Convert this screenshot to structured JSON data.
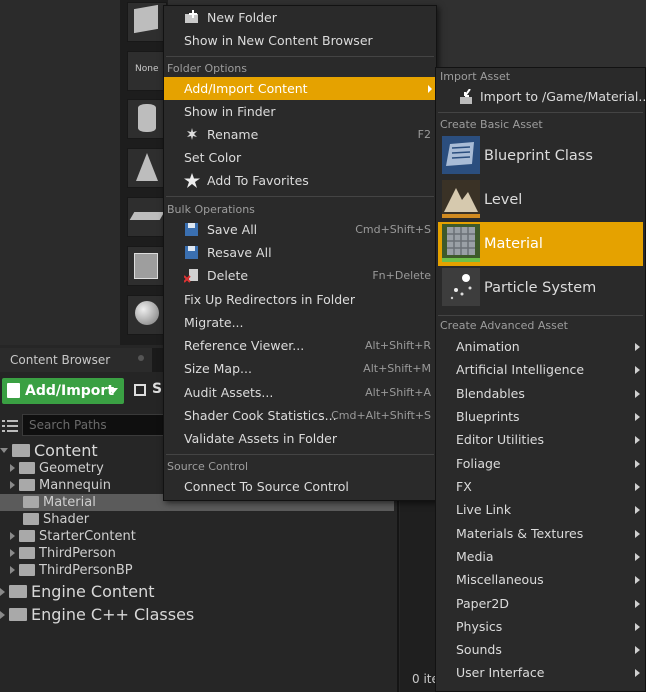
{
  "viewport": {
    "mode_tiles": [
      {
        "name": "cube-icon",
        "label": ""
      },
      {
        "name": "none-tile",
        "label": "None"
      },
      {
        "name": "cylinder-icon",
        "label": ""
      },
      {
        "name": "cone-icon",
        "label": ""
      },
      {
        "name": "plane-icon",
        "label": ""
      },
      {
        "name": "box-icon",
        "label": ""
      },
      {
        "name": "sphere-icon",
        "label": ""
      }
    ]
  },
  "content_browser": {
    "tab_label": "Content Browser",
    "add_import_label": "Add/Import",
    "save_label": "S",
    "search_placeholder": "Search Paths",
    "tree": [
      {
        "label": "Content",
        "level": 0,
        "expanded": true,
        "big": true
      },
      {
        "label": "Geometry",
        "level": 1,
        "expanded": false
      },
      {
        "label": "Mannequin",
        "level": 1,
        "expanded": false
      },
      {
        "label": "Material",
        "level": 1,
        "expanded": null,
        "selected": true
      },
      {
        "label": "Shader",
        "level": 1,
        "expanded": null
      },
      {
        "label": "StarterContent",
        "level": 1,
        "expanded": false
      },
      {
        "label": "ThirdPerson",
        "level": 1,
        "expanded": false
      },
      {
        "label": "ThirdPersonBP",
        "level": 1,
        "expanded": false
      },
      {
        "label": "Engine Content",
        "level": 0,
        "expanded": false,
        "big": true
      },
      {
        "label": "Engine C++ Classes",
        "level": 0,
        "expanded": false,
        "big": true
      }
    ],
    "items_count": "0 ite"
  },
  "context_menu": {
    "items_top": [
      {
        "label": "New Folder",
        "icon": "new-folder-icon"
      },
      {
        "label": "Show in New Content Browser",
        "icon": ""
      }
    ],
    "folder_options_title": "Folder Options",
    "folder_options": [
      {
        "label": "Add/Import Content",
        "shortcut": "",
        "icon": "",
        "highlighted": true,
        "submenu": true
      },
      {
        "label": "Show in Finder",
        "shortcut": "",
        "icon": ""
      },
      {
        "label": "Rename",
        "shortcut": "F2",
        "icon": "rename-icon"
      },
      {
        "label": "Set Color",
        "shortcut": "",
        "icon": ""
      },
      {
        "label": "Add To Favorites",
        "shortcut": "",
        "icon": "star-icon"
      }
    ],
    "bulk_title": "Bulk Operations",
    "bulk": [
      {
        "label": "Save All",
        "shortcut": "Cmd+Shift+S",
        "icon": "save-icon"
      },
      {
        "label": "Resave All",
        "shortcut": "",
        "icon": "resave-icon"
      },
      {
        "label": "Delete",
        "shortcut": "Fn+Delete",
        "icon": "delete-icon"
      },
      {
        "label": "Fix Up Redirectors in Folder",
        "shortcut": "",
        "icon": ""
      },
      {
        "label": "Migrate...",
        "shortcut": "",
        "icon": ""
      },
      {
        "label": "Reference Viewer...",
        "shortcut": "Alt+Shift+R",
        "icon": ""
      },
      {
        "label": "Size Map...",
        "shortcut": "Alt+Shift+M",
        "icon": ""
      },
      {
        "label": "Audit Assets...",
        "shortcut": "Alt+Shift+A",
        "icon": ""
      },
      {
        "label": "Shader Cook Statistics...",
        "shortcut": "Cmd+Alt+Shift+S",
        "icon": ""
      },
      {
        "label": "Validate Assets in Folder",
        "shortcut": "",
        "icon": ""
      }
    ],
    "source_control_title": "Source Control",
    "source_control": [
      {
        "label": "Connect To Source Control",
        "shortcut": "",
        "icon": ""
      }
    ]
  },
  "submenu": {
    "import_title": "Import Asset",
    "import_item": "Import to /Game/Material...",
    "basic_title": "Create Basic Asset",
    "basic": [
      {
        "label": "Blueprint Class",
        "icon": "blueprint-class-icon"
      },
      {
        "label": "Level",
        "icon": "level-icon"
      },
      {
        "label": "Material",
        "icon": "material-icon",
        "highlighted": true
      },
      {
        "label": "Particle System",
        "icon": "particle-system-icon"
      }
    ],
    "advanced_title": "Create Advanced Asset",
    "advanced": [
      "Animation",
      "Artificial Intelligence",
      "Blendables",
      "Blueprints",
      "Editor Utilities",
      "Foliage",
      "FX",
      "Live Link",
      "Materials & Textures",
      "Media",
      "Miscellaneous",
      "Paper2D",
      "Physics",
      "Sounds",
      "User Interface"
    ]
  },
  "colors": {
    "highlight": "#e5a200",
    "add_import_green": "#3aa043"
  }
}
